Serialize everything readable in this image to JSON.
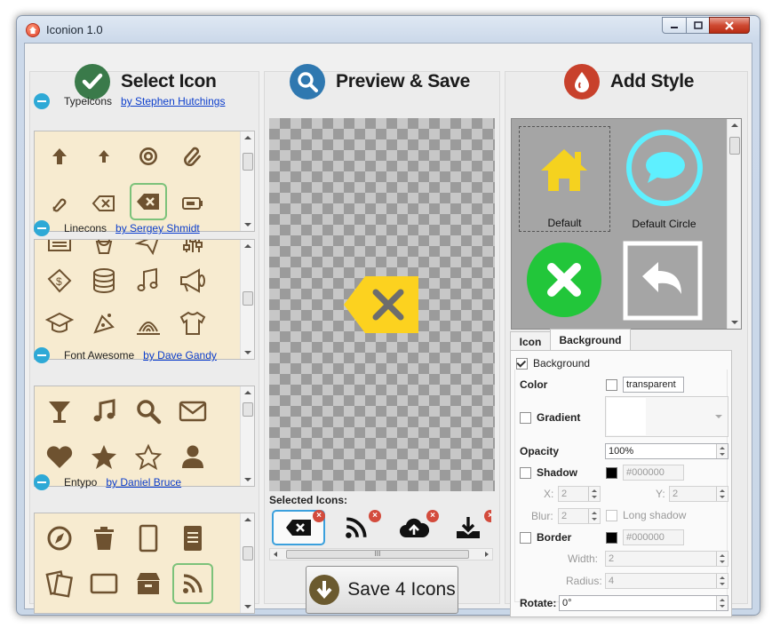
{
  "window": {
    "title": "Iconion 1.0"
  },
  "columns": {
    "select_title": "Select Icon",
    "preview_title": "Preview & Save",
    "style_title": "Add Style"
  },
  "icon_sets": [
    {
      "name": "Typeicons",
      "author": "by Stephen Hutchings",
      "icons": [
        "arrow-up",
        "arrow-up-thin",
        "at-sign",
        "paperclip",
        "link",
        "delete-left",
        "delete-filled",
        "battery"
      ]
    },
    {
      "name": "Linecons",
      "author": "by Sergey Shmidt",
      "icons": [
        "news",
        "cupcake",
        "paperplane",
        "settings",
        "banknote",
        "database",
        "music",
        "megaphone",
        "graduation-cap",
        "food",
        "fire",
        "t-shirt"
      ]
    },
    {
      "name": "Font Awesome",
      "author": "by Dave Gandy",
      "icons": [
        "glass",
        "music",
        "search",
        "envelope",
        "heart",
        "star",
        "star-empty",
        "user"
      ]
    },
    {
      "name": "Entypo",
      "author": "by Daniel Bruce",
      "icons": [
        "compass",
        "trash",
        "tablet",
        "doc",
        "documents",
        "window",
        "archive",
        "rss"
      ]
    }
  ],
  "selected": {
    "label": "Selected Icons:",
    "icons": [
      "delete-filled",
      "rss",
      "cloud-upload",
      "download"
    ],
    "remove_mark": "×",
    "hscroll_grip": "III"
  },
  "save_button": {
    "label": "Save 4 Icons"
  },
  "styles": [
    {
      "label": "Default",
      "color": "#f5d21f"
    },
    {
      "label": "Default Circle",
      "color": "#5ef0ff"
    },
    {
      "label": "",
      "color": "#22c63a"
    },
    {
      "label": "",
      "color": "#ffffff"
    }
  ],
  "tabs": {
    "icon": "Icon",
    "background": "Background",
    "active": "Background"
  },
  "bg_props": {
    "background_label": "Background",
    "background_checked": true,
    "color_label": "Color",
    "color_value": "transparent",
    "gradient_label": "Gradient",
    "opacity_label": "Opacity",
    "opacity_value": "100%",
    "shadow_label": "Shadow",
    "shadow_color": "#000000",
    "x_label": "X:",
    "x_value": "2",
    "y_label": "Y:",
    "y_value": "2",
    "blur_label": "Blur:",
    "blur_value": "2",
    "long_shadow_label": "Long shadow",
    "border_label": "Border",
    "border_color": "#000000",
    "width_label": "Width:",
    "width_value": "2",
    "radius_label": "Radius:",
    "radius_value": "4",
    "rotate_label": "Rotate:",
    "rotate_value": "0°"
  },
  "colors": {
    "accent_brown": "#6e5230",
    "tile_bg": "#f7ebd0",
    "preview_icon": "#fcd21f",
    "badge": "#d34b3c"
  }
}
